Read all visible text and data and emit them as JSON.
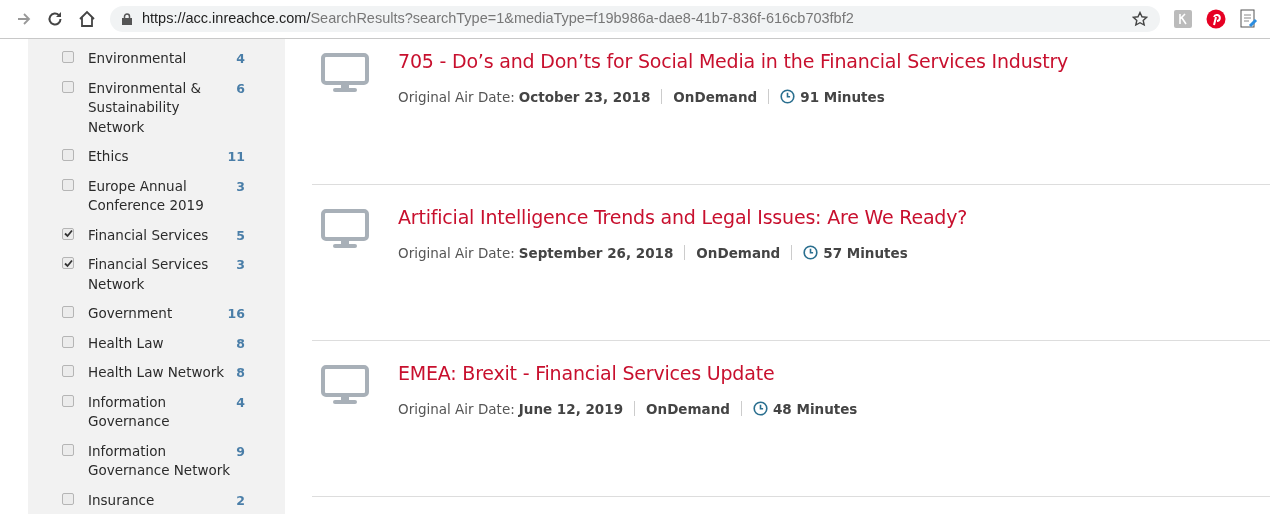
{
  "browser": {
    "url_host": "https://acc.inreachce.com/",
    "url_path": "SearchResults?searchType=1&mediaType=f19b986a-dae8-41b7-836f-616cb703fbf2"
  },
  "sidebar": {
    "items": [
      {
        "label": "Environmental",
        "count": "4",
        "checked": false
      },
      {
        "label": "Environmental & Sustainability Network",
        "count": "6",
        "checked": false
      },
      {
        "label": "Ethics",
        "count": "11",
        "checked": false
      },
      {
        "label": "Europe Annual Conference 2019",
        "count": "3",
        "checked": false
      },
      {
        "label": "Financial Services",
        "count": "5",
        "checked": true
      },
      {
        "label": "Financial Services Network",
        "count": "3",
        "checked": true
      },
      {
        "label": "Government",
        "count": "16",
        "checked": false
      },
      {
        "label": "Health Law",
        "count": "8",
        "checked": false
      },
      {
        "label": "Health Law Network",
        "count": "8",
        "checked": false
      },
      {
        "label": "Information Governance",
        "count": "4",
        "checked": false
      },
      {
        "label": "Information Governance Network",
        "count": "9",
        "checked": false
      },
      {
        "label": "Insurance",
        "count": "2",
        "checked": false
      }
    ]
  },
  "results": [
    {
      "title": "705 - Do’s and Don’ts for Social Media in the Financial Services Industry",
      "date_label": "Original Air Date:",
      "date": "October 23, 2018",
      "format": "OnDemand",
      "duration": "91 Minutes"
    },
    {
      "title": "Artificial Intelligence Trends and Legal Issues: Are We Ready?",
      "date_label": "Original Air Date:",
      "date": "September 26, 2018",
      "format": "OnDemand",
      "duration": "57 Minutes"
    },
    {
      "title": "EMEA: Brexit - Financial Services Update",
      "date_label": "Original Air Date:",
      "date": "June 12, 2019",
      "format": "OnDemand",
      "duration": "48 Minutes"
    }
  ]
}
